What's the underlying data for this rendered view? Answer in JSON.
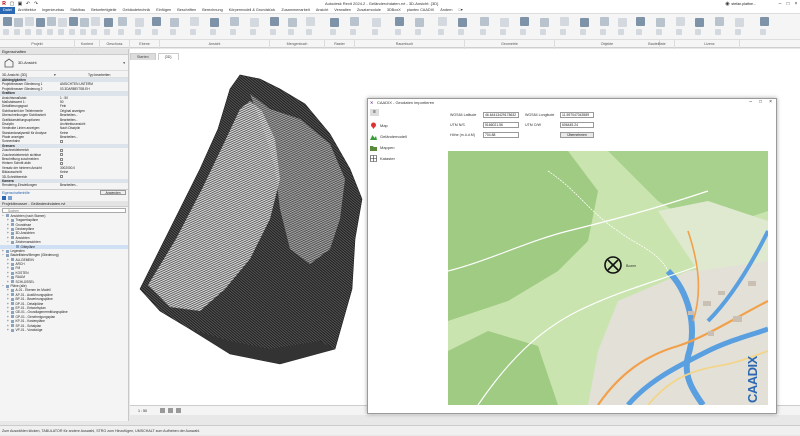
{
  "window": {
    "title": "Autodesk Revit 2024.2 - Geländerohdaten.rvt - 3D-Ansicht: {3D}",
    "user": "stefan.plattne..."
  },
  "menu": [
    {
      "label": "Datei",
      "active": true
    },
    {
      "label": "Architektur"
    },
    {
      "label": "Ingenieurbau"
    },
    {
      "label": "Stahlbau"
    },
    {
      "label": "Betonfertigteile"
    },
    {
      "label": "Gebäudetechnik"
    },
    {
      "label": "Einfügen"
    },
    {
      "label": "Beschriften"
    },
    {
      "label": "Berechnung"
    },
    {
      "label": "Körpermodell & Grundstück"
    },
    {
      "label": "Zusammenarbeit"
    },
    {
      "label": "Ansicht"
    },
    {
      "label": "Verwalten"
    },
    {
      "label": "Zusatzmodule"
    },
    {
      "label": "3DBoxX"
    },
    {
      "label": "plantec CAADIX"
    },
    {
      "label": "Ändern"
    },
    {
      "label": "□▾"
    }
  ],
  "ribbon_groups": [
    {
      "label": "Projekt"
    },
    {
      "label": "Kontext"
    },
    {
      "label": "Geschoss"
    },
    {
      "label": "Ebene"
    },
    {
      "label": "Ansicht"
    },
    {
      "label": "Mengenbuch"
    },
    {
      "label": "Raster"
    },
    {
      "label": "Raumbuch"
    },
    {
      "label": "Geometrie"
    },
    {
      "label": "Objekte"
    },
    {
      "label": "Bauteilliste"
    },
    {
      "label": "Lizenz"
    }
  ],
  "properties": {
    "header": "Eigenschaften",
    "type_name": "3D-Ansicht",
    "selector": "3D-Ansicht: {3D}",
    "edit_type": "Typ bearbeiten",
    "rows": [
      {
        "label": "Abhängigkeiten",
        "section": true
      },
      {
        "label": "Projektbrowser Gliederung 1",
        "value": "ANSICHTEN UNTERM"
      },
      {
        "label": "Projektbrowser Gliederung 2",
        "value": "03 3DARBEITSB.EH"
      },
      {
        "label": "Grafiken",
        "section": true
      },
      {
        "label": "Ansichtsmaßstab",
        "value": "1 : 50"
      },
      {
        "label": "Maßstabswert 1:",
        "value": "50"
      },
      {
        "label": "Detaillierungsgrad",
        "value": "Fein"
      },
      {
        "label": "Sichtbarkeit der Teilelemente",
        "value": "Original anzeigen"
      },
      {
        "label": "Überschreibungen Sichtbarkeit",
        "value": "Bearbeiten..."
      },
      {
        "label": "Grafikdarstellungsoptionen",
        "value": "Bearbeiten..."
      },
      {
        "label": "Disziplin",
        "value": "Architekturansicht"
      },
      {
        "label": "Verdeckte Linien anzeigen",
        "value": "Nach Disziplin"
      },
      {
        "label": "Standardanalysestil für Analyse",
        "value": "Keine"
      },
      {
        "label": "Pfade anzeigen",
        "value": "Bearbeiten..."
      },
      {
        "label": "Sonnenbahn",
        "value": ""
      },
      {
        "label": "Grenzen",
        "section": true
      },
      {
        "label": "Zuschneidebereich",
        "value": ""
      },
      {
        "label": "Zuschneidebereich sichtbar",
        "value": ""
      },
      {
        "label": "Beschriftung zuschneiden",
        "value": ""
      },
      {
        "label": "Hintsen Schnitt aktiv",
        "value": ""
      },
      {
        "label": "Versatz der hinteren Ansicht",
        "value": "3002000.0"
      },
      {
        "label": "Bildausschnitt",
        "value": "Keine"
      },
      {
        "label": "3D-Schnittbereich",
        "value": ""
      },
      {
        "label": "Kamera",
        "section": true
      },
      {
        "label": "Rendering-Einstellungen",
        "value": "Bearbeiten..."
      }
    ],
    "help": "Eigenschaftenhilfe",
    "apply": "Anwenden"
  },
  "browser": {
    "header": "Projektbrowser - Geländerohdaten.rvt",
    "search_placeholder": "Suchen",
    "items": [
      {
        "label": "Ansichten (nach Stamm)",
        "depth": 0,
        "toggle": "−"
      },
      {
        "label": "Tragwerkspläne",
        "depth": 1,
        "toggle": "+"
      },
      {
        "label": "Grundrisse",
        "depth": 1,
        "toggle": "+"
      },
      {
        "label": "Deckenpläne",
        "depth": 1,
        "toggle": "+"
      },
      {
        "label": "3D-Ansichten",
        "depth": 1,
        "toggle": "+"
      },
      {
        "label": "Ansichten",
        "depth": 1,
        "toggle": "+"
      },
      {
        "label": "Zeichenansichten",
        "depth": 1,
        "toggle": "−"
      },
      {
        "label": "Gittepläne",
        "depth": 2,
        "toggle": "",
        "selected": true
      },
      {
        "label": "Legenden",
        "depth": 0,
        "toggle": "+"
      },
      {
        "label": "Bauteillisten/Mengen (Gliederung)",
        "depth": 0,
        "toggle": "−"
      },
      {
        "label": "ALLGEMEIN",
        "depth": 1,
        "toggle": "+"
      },
      {
        "label": "ARCH",
        "depth": 1,
        "toggle": "+"
      },
      {
        "label": "FM",
        "depth": 1,
        "toggle": "+"
      },
      {
        "label": "KOSTEN",
        "depth": 1,
        "toggle": "+"
      },
      {
        "label": "RAUM",
        "depth": 1,
        "toggle": "+"
      },
      {
        "label": "SCHLÜSSEL",
        "depth": 1,
        "toggle": "+"
      },
      {
        "label": "Pläne (alle)",
        "depth": 0,
        "toggle": "−"
      },
      {
        "label": "A-01 - Ebenen im Modell",
        "depth": 1,
        "toggle": "+"
      },
      {
        "label": "AP-01 - Ausführungspläne",
        "depth": 1,
        "toggle": "+"
      },
      {
        "label": "BP-01 - Bewehrungspläne",
        "depth": 1,
        "toggle": "+"
      },
      {
        "label": "DP-01 - Detailpläne",
        "depth": 1,
        "toggle": "+"
      },
      {
        "label": "EP-01 - Entwurfsplan",
        "depth": 1,
        "toggle": "+"
      },
      {
        "label": "GE-01 - Grundlagenermittlungspläne",
        "depth": 1,
        "toggle": "+"
      },
      {
        "label": "GP-01 - Genehmigungsplan",
        "depth": 1,
        "toggle": "+"
      },
      {
        "label": "KP-01 - Kostenpläne",
        "depth": 1,
        "toggle": "+"
      },
      {
        "label": "SP-01 - Schalplan",
        "depth": 1,
        "toggle": "+"
      },
      {
        "label": "VP-01 - Vorabzüge",
        "depth": 1,
        "toggle": "+"
      }
    ]
  },
  "view_tabs": [
    {
      "label": "Starten"
    },
    {
      "label": "{3D}",
      "active": true
    }
  ],
  "view_controls": {
    "scale": "1 : 50"
  },
  "status": "Zum Auswählen klicken, TABULATOR für andere Auswahl, STRG zum Hinzufügen, UMSCHALT zum Aufheben der Auswahl.",
  "dialog": {
    "title": "CAADIX - Geodaten importieren",
    "nav": [
      {
        "label": "Map",
        "icon": "map-pin-icon"
      },
      {
        "label": "Geländemodell",
        "icon": "terrain-icon"
      },
      {
        "label": "Mappen",
        "icon": "folder-icon"
      },
      {
        "label": "Kataster",
        "icon": "cadastre-icon"
      }
    ],
    "fields": {
      "wgs_lat_label": "WGS84 Latitude",
      "wgs_lat": "46.64413429178632",
      "wgs_lon_label": "WGS84 Longitude",
      "wgs_lon": "11.597047043589",
      "utm_n_label": "UTM N/S",
      "utm_n": "5166021.56",
      "utm_e_label": "UTM O/W",
      "utm_e": "606445.24",
      "height_label": "Höhe (m.ü.d.M)",
      "height": "704.88",
      "apply_btn": "Übernehmen"
    },
    "map_town": "Bozen",
    "logo": "CAADIX",
    "colors": {
      "accent": "#2b68b3",
      "forest": "#9fcb83",
      "river": "#5a9fe0",
      "road": "#f2a04a",
      "urban": "#e3e0d8",
      "logo_blue": "#2b68b3"
    }
  }
}
